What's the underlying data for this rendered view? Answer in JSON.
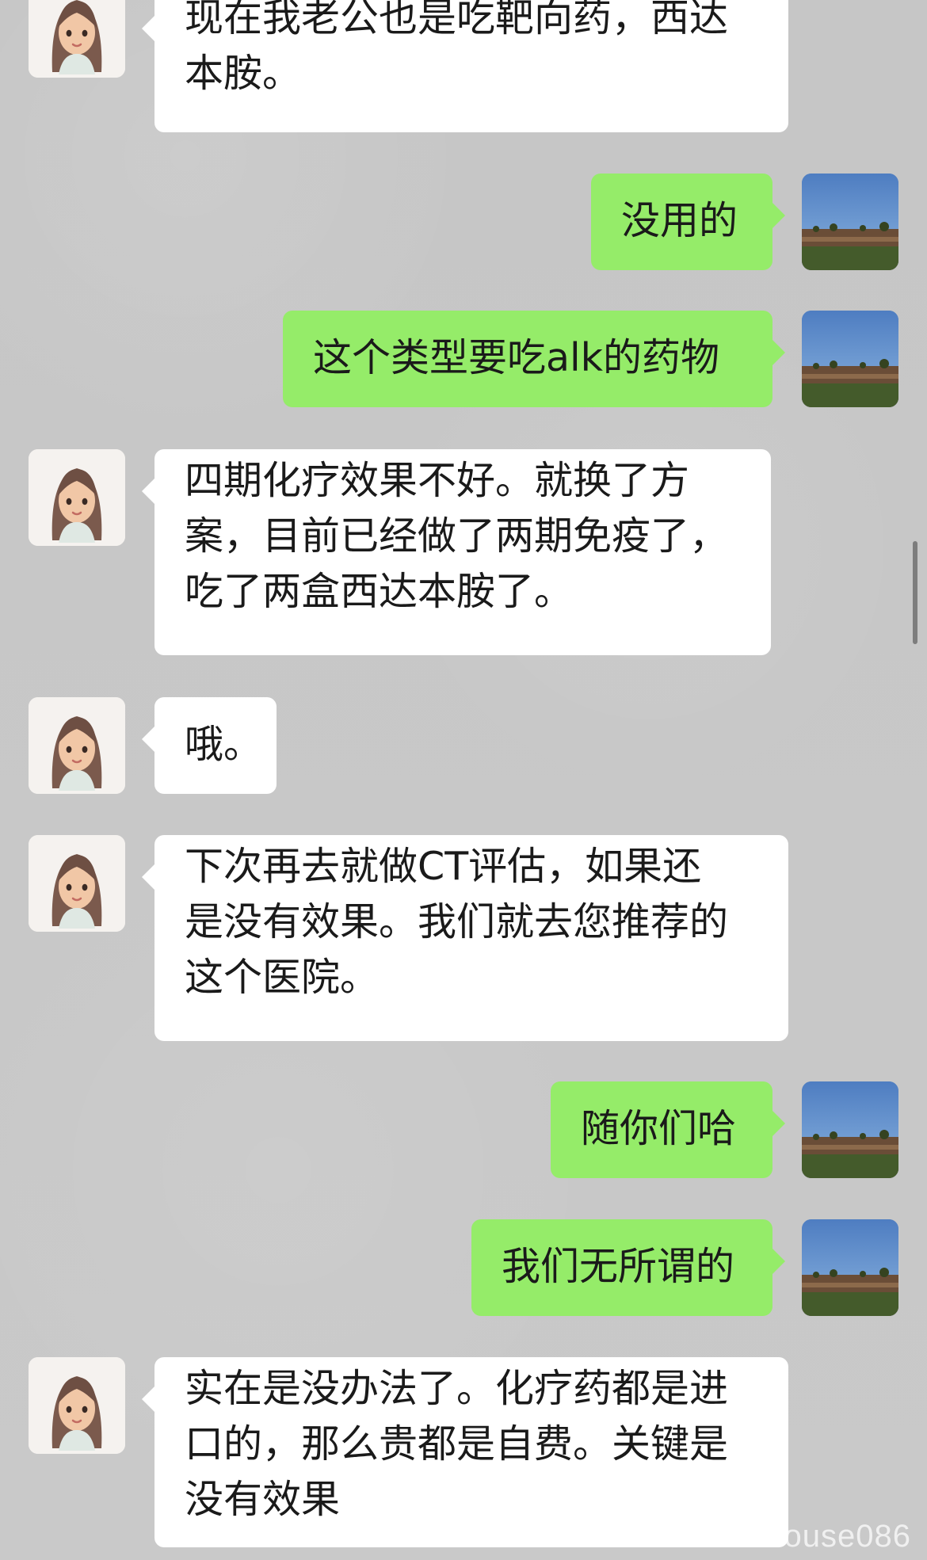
{
  "messages": [
    {
      "side": "left",
      "text": "现在我老公也是吃靶向药，西达\n本胺。"
    },
    {
      "side": "right",
      "text": "没用的"
    },
    {
      "side": "right",
      "text": "这个类型要吃alk的药物"
    },
    {
      "side": "left",
      "text": "四期化疗效果不好。就换了方\n案，目前已经做了两期免疫了，\n吃了两盒西达本胺了。"
    },
    {
      "side": "left",
      "text": "哦。"
    },
    {
      "side": "left",
      "text": "下次再去就做CT评估，如果还\n是没有效果。我们就去您推荐的\n这个医院。"
    },
    {
      "side": "right",
      "text": "随你们哈"
    },
    {
      "side": "right",
      "text": "我们无所谓的"
    },
    {
      "side": "left",
      "text": "实在是没办法了。化疗药都是进\n口的，那么贵都是自费。关键是\n没有效果"
    }
  ],
  "watermark": "ouse086",
  "icons": {
    "left_avatar": "girl-avatar-icon",
    "right_avatar": "landscape-avatar-icon"
  }
}
